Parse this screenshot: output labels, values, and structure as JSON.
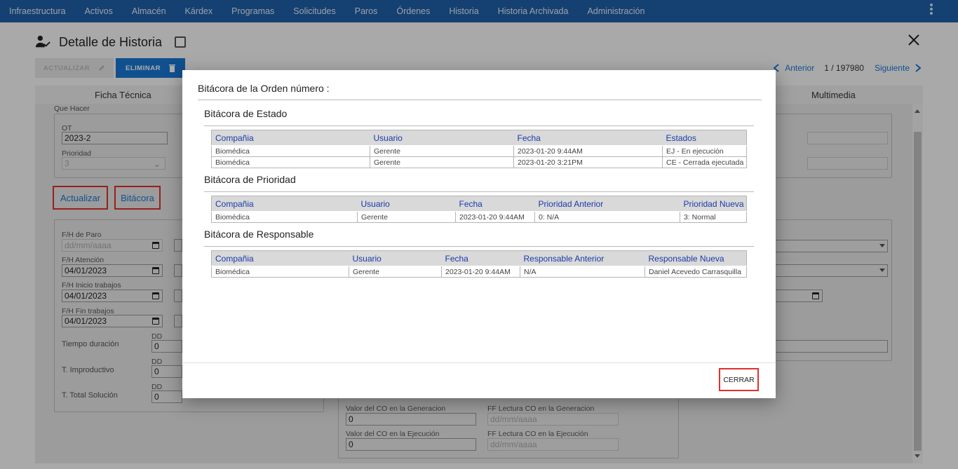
{
  "nav": {
    "items": [
      "Infraestructura",
      "Activos",
      "Almacén",
      "Kárdex",
      "Programas",
      "Solicitudes",
      "Paros",
      "Órdenes",
      "Historia",
      "Historia Archivada",
      "Administración"
    ]
  },
  "header": {
    "title": "Detalle de Historia"
  },
  "toolbar": {
    "update_label": "ACTUALIZAR",
    "delete_label": "ELIMINAR"
  },
  "pager": {
    "prev_label": "Anterior",
    "count": "1 / 197980",
    "next_label": "Siguiente"
  },
  "tabs": {
    "left": "Ficha Técnica",
    "right": "Multimedia"
  },
  "form": {
    "que_hacer_label": "Que Hacer",
    "ot_label": "OT",
    "ot_value": "2023-2",
    "prioridad_label": "Prioridad",
    "prioridad_value": "3",
    "actualizar_btn": "Actualizar",
    "bitacora_btn": "Bitácora",
    "fh_paro_label": "F/H de Paro",
    "fh_paro_placeholder": "dd/mm/aaaa",
    "fh_atencion_label": "F/H Atención",
    "fh_atencion_value": "04/01/2023",
    "fh_inicio_label": "F/H Inicio trabajos",
    "fh_inicio_value": "04/01/2023",
    "fh_fin_label": "F/H Fin trabajos",
    "fh_fin_value": "04/01/2023",
    "dd_label": "DD",
    "tiempo_duracion_label": "Tiempo duración",
    "t_improductivo_label": "T. Improductivo",
    "t_total_label": "T. Total Solución",
    "zero": "0",
    "valor_co_gen_label": "Valor del CO en la Generacion",
    "ff_lectura_gen_label": "FF Lectura CO en la Generacion",
    "valor_co_ej_label": "Valor del CO en la Ejecución",
    "ff_lectura_ej_label": "FF Lectura CO en la Ejecución",
    "date_placeholder": "dd/mm/aaaa"
  },
  "modal": {
    "title": "Bitácora de la Orden número :",
    "estado": {
      "title": "Bitácora de Estado",
      "headers": [
        "Compañia",
        "Usuario",
        "Fecha",
        "Estados"
      ],
      "rows": [
        [
          "Biomédica",
          "Gerente",
          "2023-01-20 9:44AM",
          "EJ - En ejecución"
        ],
        [
          "Biomédica",
          "Gerente",
          "2023-01-20 3:21PM",
          "CE - Cerrada ejecutada"
        ]
      ]
    },
    "prioridad": {
      "title": "Bitácora de Prioridad",
      "headers": [
        "Compañia",
        "Usuario",
        "Fecha",
        "Prioridad Anterior",
        "Prioridad Nueva"
      ],
      "rows": [
        [
          "Biomédica",
          "Gerente",
          "2023-01-20 9:44AM",
          "0: N/A",
          "3: Normal"
        ]
      ]
    },
    "responsable": {
      "title": "Bitácora de Responsable",
      "headers": [
        "Compañia",
        "Usuario",
        "Fecha",
        "Responsable Anterior",
        "Responsable Nueva"
      ],
      "rows": [
        [
          "Biomédica",
          "Gerente",
          "2023-01-20 9:44AM",
          "N/A",
          "Daniel Acevedo Carrasquilla"
        ]
      ]
    },
    "close_label": "CERRAR"
  },
  "colors": {
    "nav_bg": "#1e5fa8",
    "accent": "#1976d2",
    "highlight_border": "#e03030",
    "table_header_text": "#1a3aa8"
  }
}
